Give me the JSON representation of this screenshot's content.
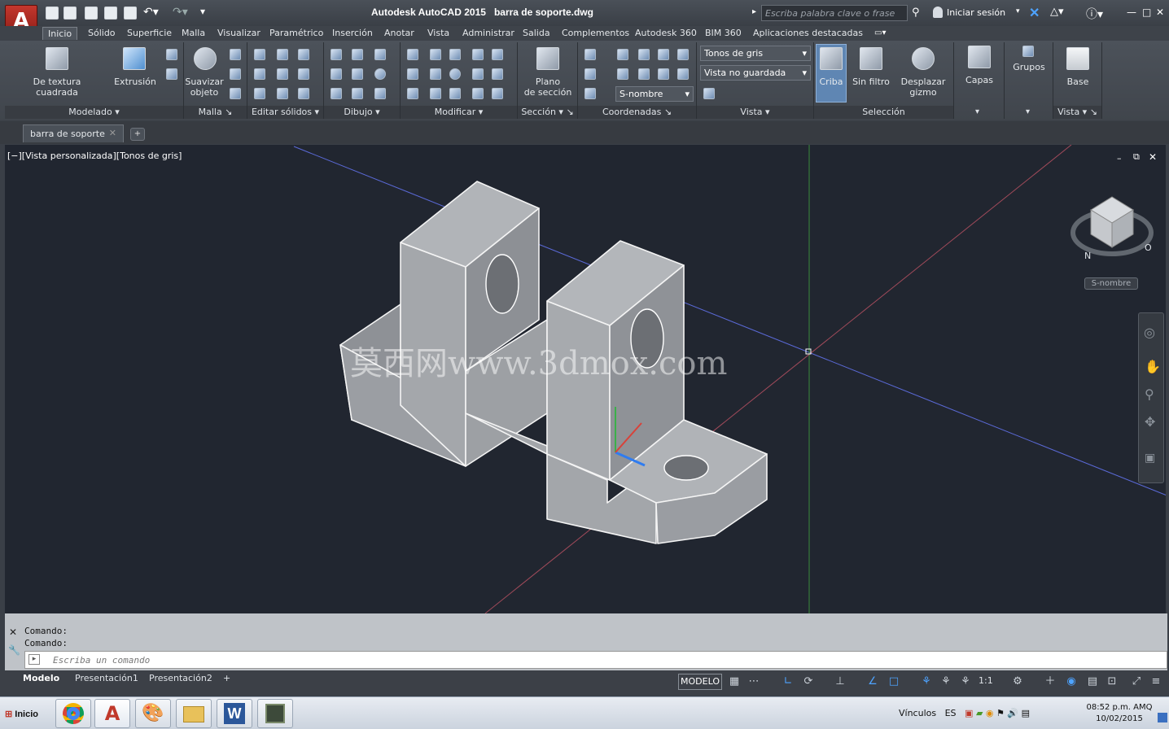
{
  "app": {
    "title": "Autodesk AutoCAD 2015",
    "filename": "barra de soporte.dwg",
    "search_placeholder": "Escriba palabra clave o frase",
    "login": "Iniciar sesión"
  },
  "ribbon_tabs": [
    "Inicio",
    "Sólido",
    "Superficie",
    "Malla",
    "Visualizar",
    "Paramétrico",
    "Inserción",
    "Anotar",
    "Vista",
    "Administrar",
    "Salida",
    "Complementos",
    "Autodesk 360",
    "BIM 360",
    "Aplicaciones destacadas"
  ],
  "panels": {
    "modelado": {
      "label": "Modelado",
      "btn1": "De textura cuadrada",
      "btn2": "Extrusión"
    },
    "malla": {
      "label": "Malla",
      "btn1": "Suavizar",
      "btn1b": "objeto"
    },
    "editar": {
      "label": "Editar sólidos"
    },
    "dibujo": {
      "label": "Dibujo"
    },
    "modificar": {
      "label": "Modificar"
    },
    "seccion": {
      "label": "Sección",
      "btn1": "Plano",
      "btn1b": "de sección"
    },
    "coordenadas": {
      "label": "Coordenadas",
      "ucs": "S-nombre"
    },
    "vista": {
      "label": "Vista",
      "style": "Tonos de gris",
      "view": "Vista no guardada"
    },
    "seleccion": {
      "label": "Selección",
      "btn1": "Criba",
      "btn2": "Sin filtro",
      "btn3": "Desplazar",
      "btn3b": "gizmo"
    },
    "capas": {
      "label": "Capas"
    },
    "grupos": {
      "label": "Grupos"
    },
    "vista2": {
      "label": "Vista",
      "btn1": "Base"
    }
  },
  "document_tab": "barra de soporte",
  "viewport": {
    "label": "[−][Vista personalizada][Tonos de gris]",
    "viewcube_label": "S-nombre",
    "watermark": "莫西网www.3dmox.com"
  },
  "command": {
    "history": [
      "Comando:",
      "Comando:"
    ],
    "placeholder": "Escriba un comando"
  },
  "layout_tabs": [
    "Modelo",
    "Presentación1",
    "Presentación2"
  ],
  "status": {
    "model": "MODELO",
    "scale": "1:1"
  },
  "taskbar": {
    "start": "Inicio",
    "tray_text": "Vínculos",
    "lang": "ES",
    "time": "08:52 p.m. AMQ",
    "date": "10/02/2015"
  }
}
